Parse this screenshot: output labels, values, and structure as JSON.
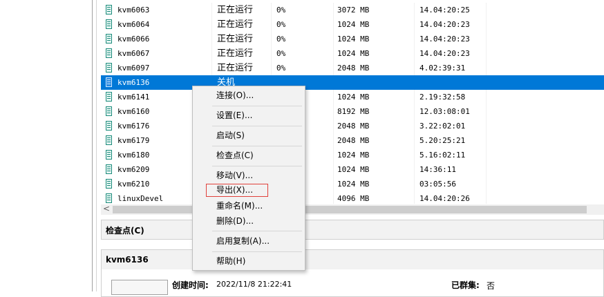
{
  "vm_list": {
    "rows": [
      {
        "name": "kvm6063",
        "state": "正在运行",
        "cpu": "0%",
        "memory": "3072 MB",
        "uptime": "14.04:20:25"
      },
      {
        "name": "kvm6064",
        "state": "正在运行",
        "cpu": "0%",
        "memory": "1024 MB",
        "uptime": "14.04:20:23"
      },
      {
        "name": "kvm6066",
        "state": "正在运行",
        "cpu": "0%",
        "memory": "1024 MB",
        "uptime": "14.04:20:23"
      },
      {
        "name": "kvm6067",
        "state": "正在运行",
        "cpu": "0%",
        "memory": "1024 MB",
        "uptime": "14.04:20:23"
      },
      {
        "name": "kvm6097",
        "state": "正在运行",
        "cpu": "0%",
        "memory": "2048 MB",
        "uptime": "4.02:39:31"
      },
      {
        "name": "kvm6136",
        "state": "关机",
        "cpu": "",
        "memory": "",
        "uptime": "",
        "selected": true
      },
      {
        "name": "kvm6141",
        "state": "",
        "cpu": "",
        "memory": "1024 MB",
        "uptime": "2.19:32:58"
      },
      {
        "name": "kvm6160",
        "state": "",
        "cpu": "",
        "memory": "8192 MB",
        "uptime": "12.03:08:01"
      },
      {
        "name": "kvm6176",
        "state": "",
        "cpu": "",
        "memory": "2048 MB",
        "uptime": "3.22:02:01"
      },
      {
        "name": "kvm6179",
        "state": "",
        "cpu": "",
        "memory": "2048 MB",
        "uptime": "5.20:25:21"
      },
      {
        "name": "kvm6180",
        "state": "",
        "cpu": "",
        "memory": "1024 MB",
        "uptime": "5.16:02:11"
      },
      {
        "name": "kvm6209",
        "state": "",
        "cpu": "",
        "memory": "1024 MB",
        "uptime": "14:36:11"
      },
      {
        "name": "kvm6210",
        "state": "",
        "cpu": "",
        "memory": "1024 MB",
        "uptime": "03:05:56"
      },
      {
        "name": "linuxDevel",
        "state": "",
        "cpu": "",
        "memory": "4096 MB",
        "uptime": "14.04:20:26"
      }
    ]
  },
  "scrollbar": {
    "left_arrow": "<"
  },
  "checkpoints_panel": {
    "title": "检查点(C)"
  },
  "details_panel": {
    "title": "kvm6136",
    "created_label": "创建时间:",
    "created_value": "2022/11/8 21:22:41",
    "clustered_label": "已群集:",
    "clustered_value": "否"
  },
  "context_menu": {
    "connect": "连接(O)...",
    "settings": "设置(E)...",
    "start": "启动(S)",
    "checkpoint": "检查点(C)",
    "move": "移动(V)...",
    "export": "导出(X)...",
    "rename": "重命名(M)...",
    "delete": "删除(D)...",
    "enable_replication": "启用复制(A)...",
    "help": "帮助(H)"
  },
  "colors": {
    "selection": "#0078d7",
    "highlight_box": "#e0403a",
    "vm_icon": "#1a8a7a"
  }
}
